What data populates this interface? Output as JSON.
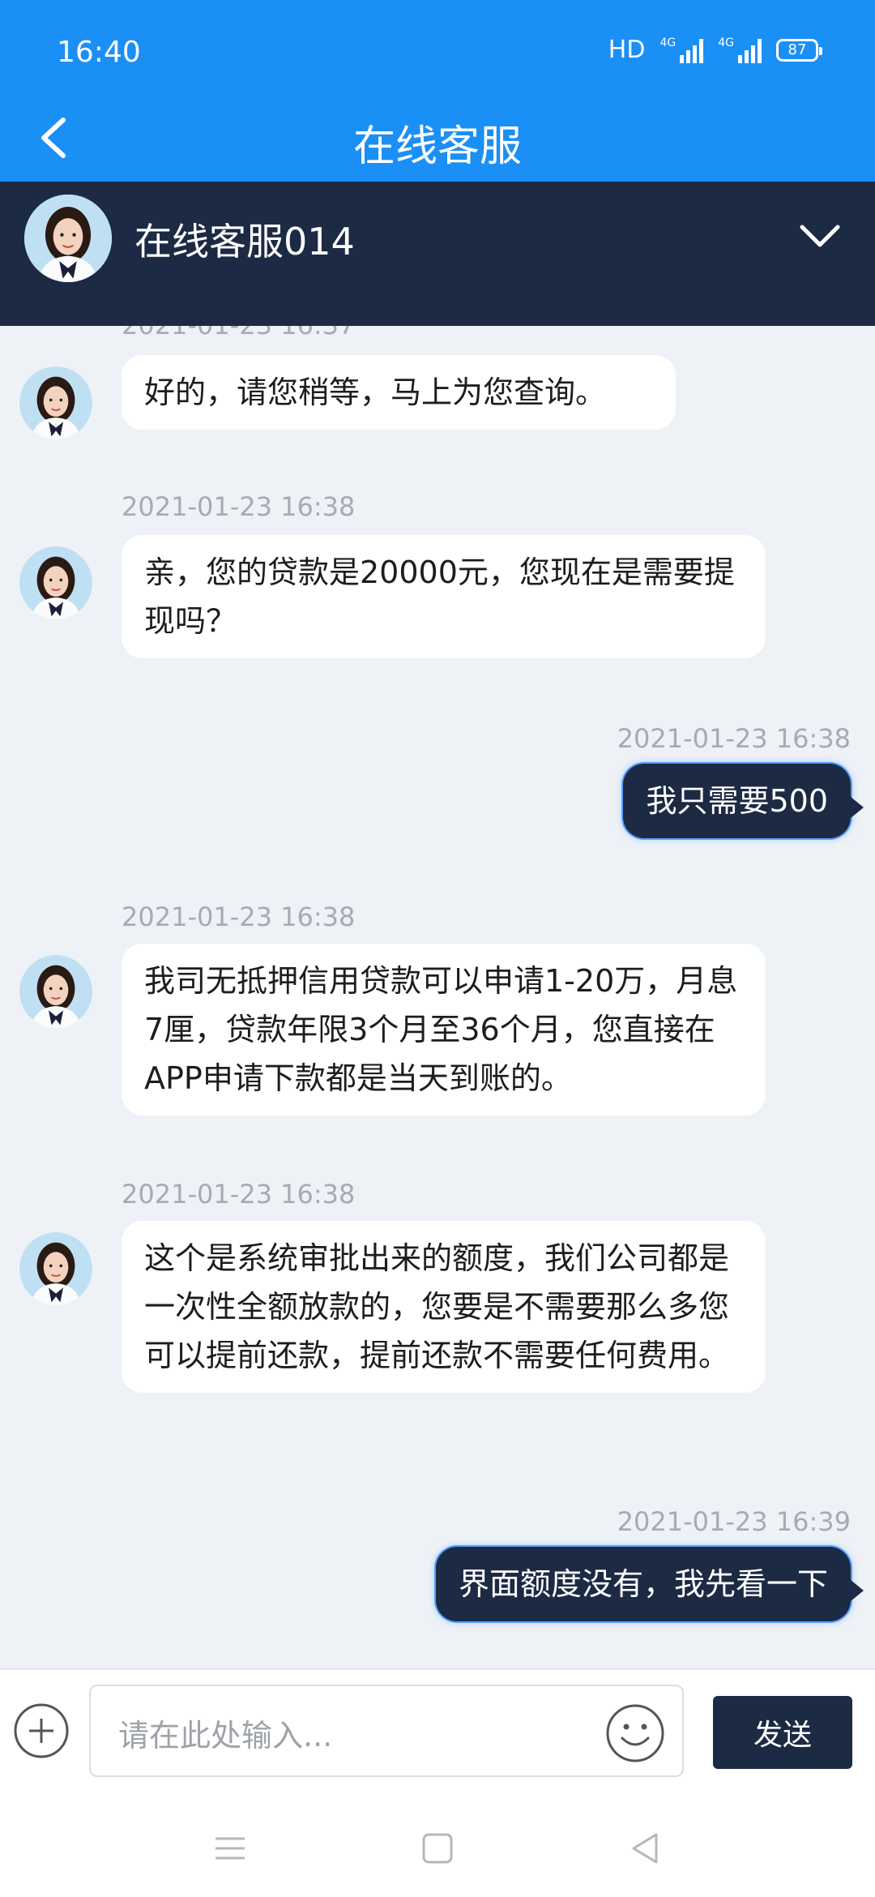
{
  "status_bar": {
    "time": "16:40",
    "hd": "HD",
    "net1": "4G",
    "net2": "4G",
    "battery": "87"
  },
  "header": {
    "title": "在线客服"
  },
  "agent": {
    "name": "在线客服014"
  },
  "messages": [
    {
      "side": "in",
      "time": "2021-01-23 16:37",
      "text": "好的，请您稍等，马上为您查询。"
    },
    {
      "side": "in",
      "time": "2021-01-23 16:38",
      "text": "亲，您的贷款是20000元，您现在是需要提现吗？"
    },
    {
      "side": "out",
      "time": "2021-01-23 16:38",
      "text": "我只需要500"
    },
    {
      "side": "in",
      "time": "2021-01-23 16:38",
      "text": "我司无抵押信用贷款可以申请1-20万，月息7厘，贷款年限3个月至36个月，您直接在APP申请下款都是当天到账的。"
    },
    {
      "side": "in",
      "time": "2021-01-23 16:38",
      "text": "这个是系统审批出来的额度，我们公司都是一次性全额放款的，您要是不需要那么多您可以提前还款，提前还款不需要任何费用。"
    },
    {
      "side": "out",
      "time": "2021-01-23 16:39",
      "text": "界面额度没有，我先看一下"
    }
  ],
  "composer": {
    "placeholder": "请在此处输入...",
    "send_label": "发送"
  },
  "icons": {
    "back": "back-arrow-icon",
    "expand": "chevron-down-icon",
    "add": "plus-circle-icon",
    "emoji": "smile-icon"
  },
  "colors": {
    "header": "#1a8ff5",
    "agent_bar": "#1c2a44",
    "chat_bg": "#eef2f7",
    "out_bubble": "#1c2a44"
  }
}
